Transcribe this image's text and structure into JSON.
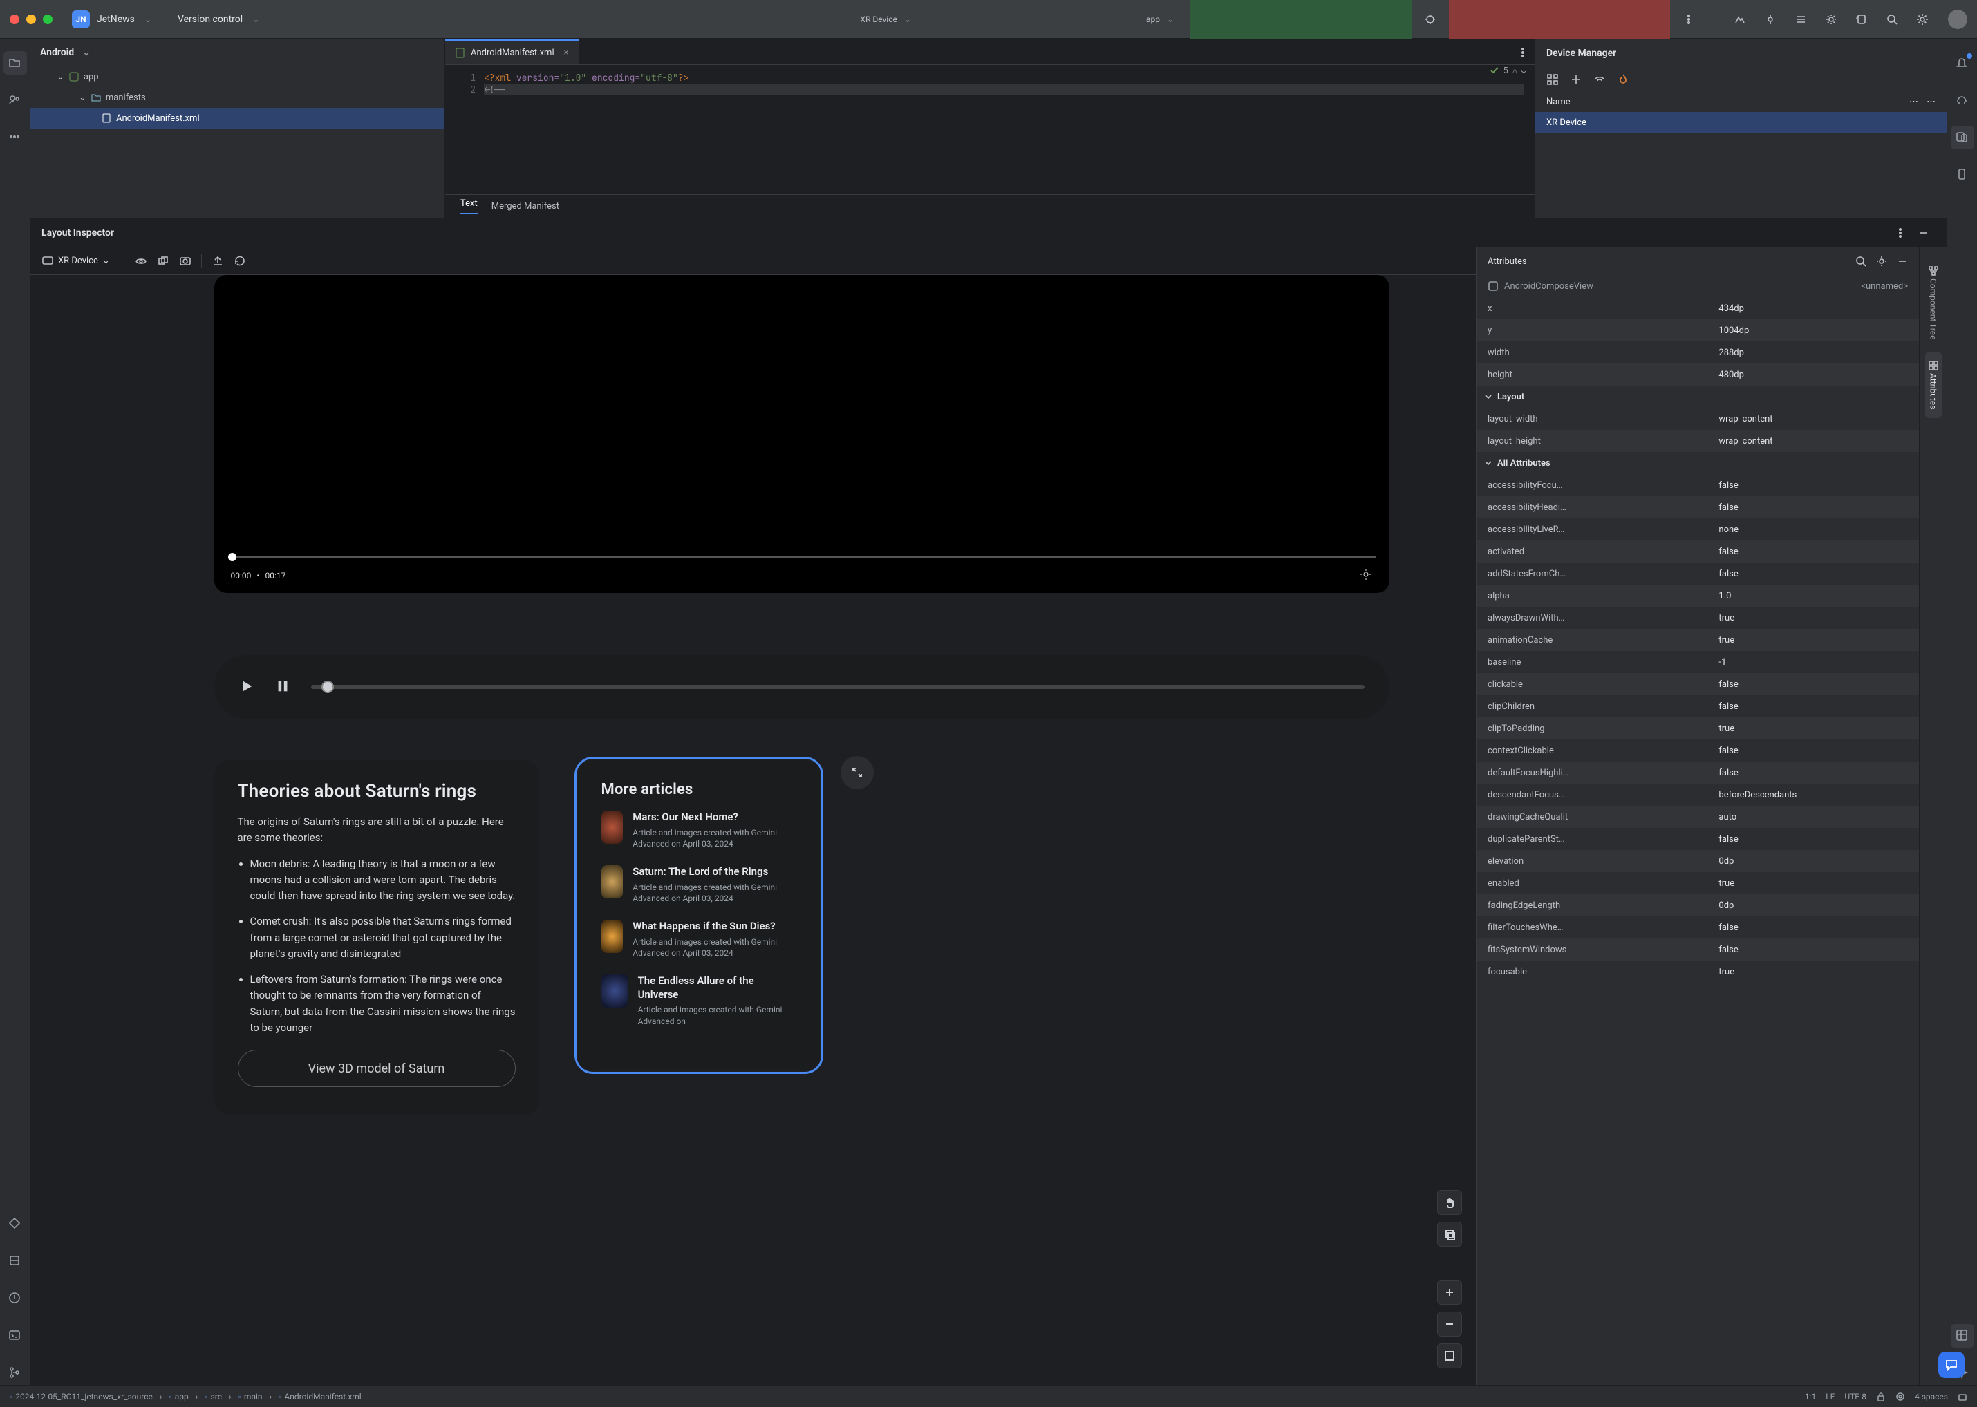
{
  "titlebar": {
    "project_badge": "JN",
    "project_name": "JetNews",
    "vcs_label": "Version control",
    "run_target_device": "XR Device",
    "run_target_module": "app"
  },
  "project_view": {
    "dropdown": "Android",
    "nodes": {
      "root": "app",
      "manifests": "manifests",
      "manifest_file": "AndroidManifest.xml"
    }
  },
  "editor": {
    "tab_label": "AndroidManifest.xml",
    "problems_count": "5",
    "subtabs": {
      "text": "Text",
      "merged": "Merged Manifest"
    },
    "code": {
      "l1_open": "<?",
      "l1_xml": "xml ",
      "l1_ver_attr": "version=",
      "l1_ver_val": "\"1.0\"",
      "l1_enc_attr": " encoding=",
      "l1_enc_val": "\"utf-8\"",
      "l1_close": "?>",
      "l2": "<!--"
    },
    "line1": "1",
    "line2": "2"
  },
  "device_manager": {
    "title": "Device Manager",
    "col_name": "Name",
    "device": "XR Device"
  },
  "layout_inspector": {
    "title": "Layout Inspector",
    "device_selector": "XR Device"
  },
  "preview": {
    "video": {
      "time_cur": "00:00",
      "time_dot": "•",
      "time_total": "00:17"
    },
    "fab_tooltip": "expand",
    "theories": {
      "title": "Theories about Saturn's rings",
      "intro": "The origins of Saturn's rings are still a bit of a puzzle. Here are some theories:",
      "b1": "Moon debris: A leading theory is that a moon or a few moons had a collision and were torn apart. The debris could then have spread into the ring system we see today.",
      "b2": "Comet crush: It's also possible that Saturn's rings formed from a large comet or asteroid that got captured by the planet's gravity and disintegrated",
      "b3": "Leftovers from Saturn's formation: The rings were once thought to be remnants from the very formation of Saturn, but data from the Cassini mission shows the rings to be younger",
      "button": "View 3D model of Saturn"
    },
    "more": {
      "title": "More articles",
      "items": [
        {
          "title": "Mars: Our Next Home?",
          "sub": "Article and images created with Gemini Advanced on April 03, 2024",
          "thumb": "mars"
        },
        {
          "title": "Saturn: The Lord of the Rings",
          "sub": "Article and images created with Gemini Advanced on April 03, 2024",
          "thumb": "saturn"
        },
        {
          "title": "What Happens if the Sun Dies?",
          "sub": "Article and images created with Gemini Advanced on April 03, 2024",
          "thumb": "sun"
        },
        {
          "title": "The Endless Allure of the Universe",
          "sub": "Article and images created with Gemini Advanced on",
          "thumb": "uni"
        }
      ]
    }
  },
  "attributes": {
    "panel_title": "Attributes",
    "element_type": "AndroidComposeView",
    "element_id": "<unnamed>",
    "basic": [
      {
        "k": "x",
        "v": "434dp"
      },
      {
        "k": "y",
        "v": "1004dp"
      },
      {
        "k": "width",
        "v": "288dp"
      },
      {
        "k": "height",
        "v": "480dp"
      }
    ],
    "group_layout": "Layout",
    "layout": [
      {
        "k": "layout_width",
        "v": "wrap_content"
      },
      {
        "k": "layout_height",
        "v": "wrap_content"
      }
    ],
    "group_all": "All Attributes",
    "all": [
      {
        "k": "accessibilityFocu…",
        "v": "false"
      },
      {
        "k": "accessibilityHeadi…",
        "v": "false"
      },
      {
        "k": "accessibilityLiveR…",
        "v": "none"
      },
      {
        "k": "activated",
        "v": "false"
      },
      {
        "k": "addStatesFromCh…",
        "v": "false"
      },
      {
        "k": "alpha",
        "v": "1.0"
      },
      {
        "k": "alwaysDrawnWith…",
        "v": "true"
      },
      {
        "k": "animationCache",
        "v": "true"
      },
      {
        "k": "baseline",
        "v": "-1"
      },
      {
        "k": "clickable",
        "v": "false"
      },
      {
        "k": "clipChildren",
        "v": "false"
      },
      {
        "k": "clipToPadding",
        "v": "true"
      },
      {
        "k": "contextClickable",
        "v": "false"
      },
      {
        "k": "defaultFocusHighli…",
        "v": "false"
      },
      {
        "k": "descendantFocus…",
        "v": "beforeDescendants"
      },
      {
        "k": "drawingCacheQualit",
        "v": "auto"
      },
      {
        "k": "duplicateParentSt…",
        "v": "false"
      },
      {
        "k": "elevation",
        "v": "0dp"
      },
      {
        "k": "enabled",
        "v": "true"
      },
      {
        "k": "fadingEdgeLength",
        "v": "0dp"
      },
      {
        "k": "filterTouchesWhe…",
        "v": "false"
      },
      {
        "k": "fitsSystemWindows",
        "v": "false"
      },
      {
        "k": "focusable",
        "v": "true"
      }
    ]
  },
  "side_tabs": {
    "component_tree": "Component Tree",
    "attributes": "Attributes"
  },
  "breadcrumbs": [
    "2024-12-05_RC11_jetnews_xr_source",
    "app",
    "src",
    "main",
    "AndroidManifest.xml"
  ],
  "statusbar": {
    "caret": "1:1",
    "eol": "LF",
    "encoding": "UTF-8",
    "indent": "4 spaces"
  }
}
